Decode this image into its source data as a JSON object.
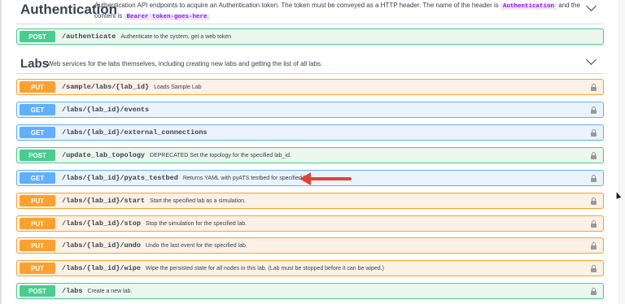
{
  "auth": {
    "title": "Authentication",
    "desc_part1": "Authentication API endpoints to acquire an Authentication token. The token must be conveyed as a HTTP header. The name of the header is",
    "header_name": "Authentication",
    "desc_part2": "and the content is",
    "header_value": "Bearer token-goes-here"
  },
  "auth_ops": [
    {
      "method": "POST",
      "path": "/authenticate",
      "summary": "Authenticate to the system, get a web token"
    }
  ],
  "labs": {
    "title": "Labs",
    "desc": "Web services for the labs themselves, including creating new labs and getting the list of all labs."
  },
  "labs_ops": [
    {
      "method": "PUT",
      "path": "/sample/labs/{lab_id}",
      "summary": "Loads Sample Lab"
    },
    {
      "method": "GET",
      "path": "/labs/{lab_id}/events",
      "summary": ""
    },
    {
      "method": "GET",
      "path": "/labs/{lab_id}/external_connections",
      "summary": ""
    },
    {
      "method": "POST",
      "path": "/update_lab_topology",
      "summary": "DEPRECATED Set the topology for the specified lab_id."
    },
    {
      "method": "GET",
      "path": "/labs/{lab_id}/pyats_testbed",
      "summary": "Returns YAML with pyATS testbed for specified lab."
    },
    {
      "method": "PUT",
      "path": "/labs/{lab_id}/start",
      "summary": "Start the specified lab as a simulation."
    },
    {
      "method": "PUT",
      "path": "/labs/{lab_id}/stop",
      "summary": "Stop the simulation for the specified lab."
    },
    {
      "method": "PUT",
      "path": "/labs/{lab_id}/undo",
      "summary": "Undo the last event for the specified lab."
    },
    {
      "method": "PUT",
      "path": "/labs/{lab_id}/wipe",
      "summary": "Wipe the persisted state for all nodes in this lab. (Lab must be stopped before it can be wiped.)"
    },
    {
      "method": "POST",
      "path": "/labs",
      "summary": "Create a new lab."
    }
  ],
  "colors": {
    "post": "#49cc90",
    "get": "#61affe",
    "put": "#fca130",
    "annotation_arrow": "#e0433a"
  }
}
